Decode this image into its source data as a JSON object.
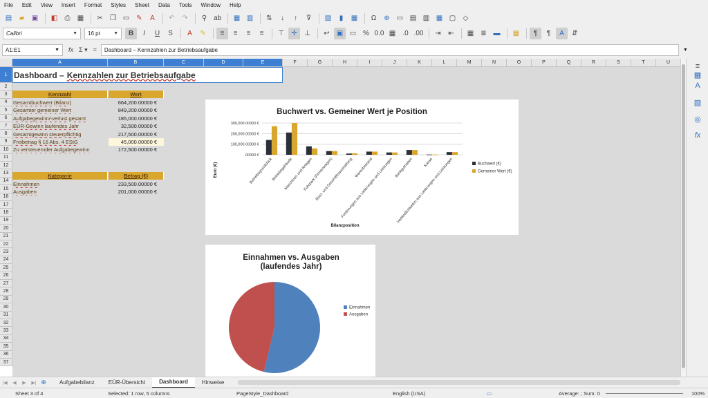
{
  "menu": [
    "File",
    "Edit",
    "View",
    "Insert",
    "Format",
    "Styles",
    "Sheet",
    "Data",
    "Tools",
    "Window",
    "Help"
  ],
  "font": {
    "name": "Calibri",
    "size": "16 pt"
  },
  "formula_bar": {
    "cell_ref": "A1:E1",
    "content": "Dashboard – Kennzahlen zur Betriebsaufgabe"
  },
  "columns": [
    "A",
    "B",
    "C",
    "D",
    "E",
    "F",
    "G",
    "H",
    "I",
    "J",
    "K",
    "L",
    "M",
    "N",
    "O",
    "P",
    "Q",
    "R",
    "S",
    "T",
    "U"
  ],
  "rows": [
    "1",
    "2",
    "3",
    "4",
    "5",
    "6",
    "7",
    "8",
    "9",
    "10",
    "11",
    "12",
    "13",
    "14",
    "15",
    "16",
    "17",
    "18",
    "19",
    "20",
    "21",
    "22",
    "23",
    "24",
    "25",
    "26",
    "27",
    "28",
    "29",
    "30",
    "31",
    "32",
    "33",
    "34",
    "35",
    "36",
    "37"
  ],
  "sheet": {
    "title_prefix": "Dashboard –",
    "title_rest": "Kennzahlen zur Betriebsaufgabe",
    "table1": {
      "headers": [
        "Kennzahl",
        "Wert"
      ],
      "rows": [
        {
          "label": "Gesamtbuchwert (Bilanz)",
          "value": "664,200.00000 €"
        },
        {
          "label": "Gesamter gemeiner Wert",
          "value": "849,200.00000 €"
        },
        {
          "label": "Aufgabegewinn/-verlust gesamt",
          "value": "185,000.00000 €"
        },
        {
          "label": "EÜR-Gewinn laufendes Jahr",
          "value": "32,500.00000 €"
        },
        {
          "label": "Gesamtgewinn steuerpflichtig",
          "value": "217,500.00000 €"
        },
        {
          "label": "Freibetrag § 16 Abs. 4 EStG",
          "value": "45,000.00000 €"
        },
        {
          "label": "Zu versteuernder Aufgabegewinn",
          "value": "172,500.00000 €"
        }
      ]
    },
    "table2": {
      "headers": [
        "Kategorie",
        "Betrag (€)"
      ],
      "rows": [
        {
          "label": "Einnahmen",
          "value": "233,500.00000 €"
        },
        {
          "label": "Ausgaben",
          "value": "201,000.00000 €"
        }
      ]
    }
  },
  "chart_data": [
    {
      "type": "bar",
      "title": "Buchwert vs. Gemeiner Wert je Position",
      "xlabel": "Bilanzposition",
      "ylabel": "Euro (€)",
      "ylim": [
        0,
        300000
      ],
      "yticks": [
        ".00000 €",
        "100,000.00000 €",
        "200,000.00000 €",
        "300,000.00000 €"
      ],
      "legend": "right",
      "categories": [
        "Betriebsgrundstück",
        "Betriebsgebäude",
        "Maschinen und Anlagen",
        "Fuhrpark (Firmenwagen)",
        "Büro- und Geschäftsausstattung",
        "Warenbestand",
        "Forderungen aus Lieferungen und Leistungen",
        "Bankguthaben",
        "Kasse",
        "Verbindlichkeiten aus Lieferungen und Leistungen"
      ],
      "series": [
        {
          "name": "Buchwert (€)",
          "color": "#2b2f38",
          "values": [
            140000,
            210000,
            80000,
            35000,
            12000,
            30000,
            22000,
            45000,
            2000,
            25000
          ]
        },
        {
          "name": "Gemeiner Wert (€)",
          "color": "#d9a62e",
          "values": [
            270000,
            300000,
            60000,
            35000,
            14000,
            30000,
            22000,
            45000,
            2000,
            25000
          ]
        }
      ]
    },
    {
      "type": "pie",
      "title": [
        "Einnahmen vs. Ausgaben",
        "(laufendes Jahr)"
      ],
      "legend": "right",
      "categories": [
        "Einnahmen",
        "Ausgaben"
      ],
      "values": [
        233500,
        201000
      ],
      "colors": [
        "#4f81bd",
        "#c0504d"
      ]
    }
  ],
  "tabs": [
    "Aufgabebilanz",
    "EÜR-Übersicht",
    "Dashboard",
    "Hinweise"
  ],
  "active_tab": "Dashboard",
  "status": {
    "sheet": "Sheet 3 of 4",
    "selection": "Selected: 1 row, 5 columns",
    "pagestyle": "PageStyle_Dashboard",
    "language": "English (USA)",
    "sum": "Average: ; Sum: 0",
    "zoom": "100%"
  }
}
